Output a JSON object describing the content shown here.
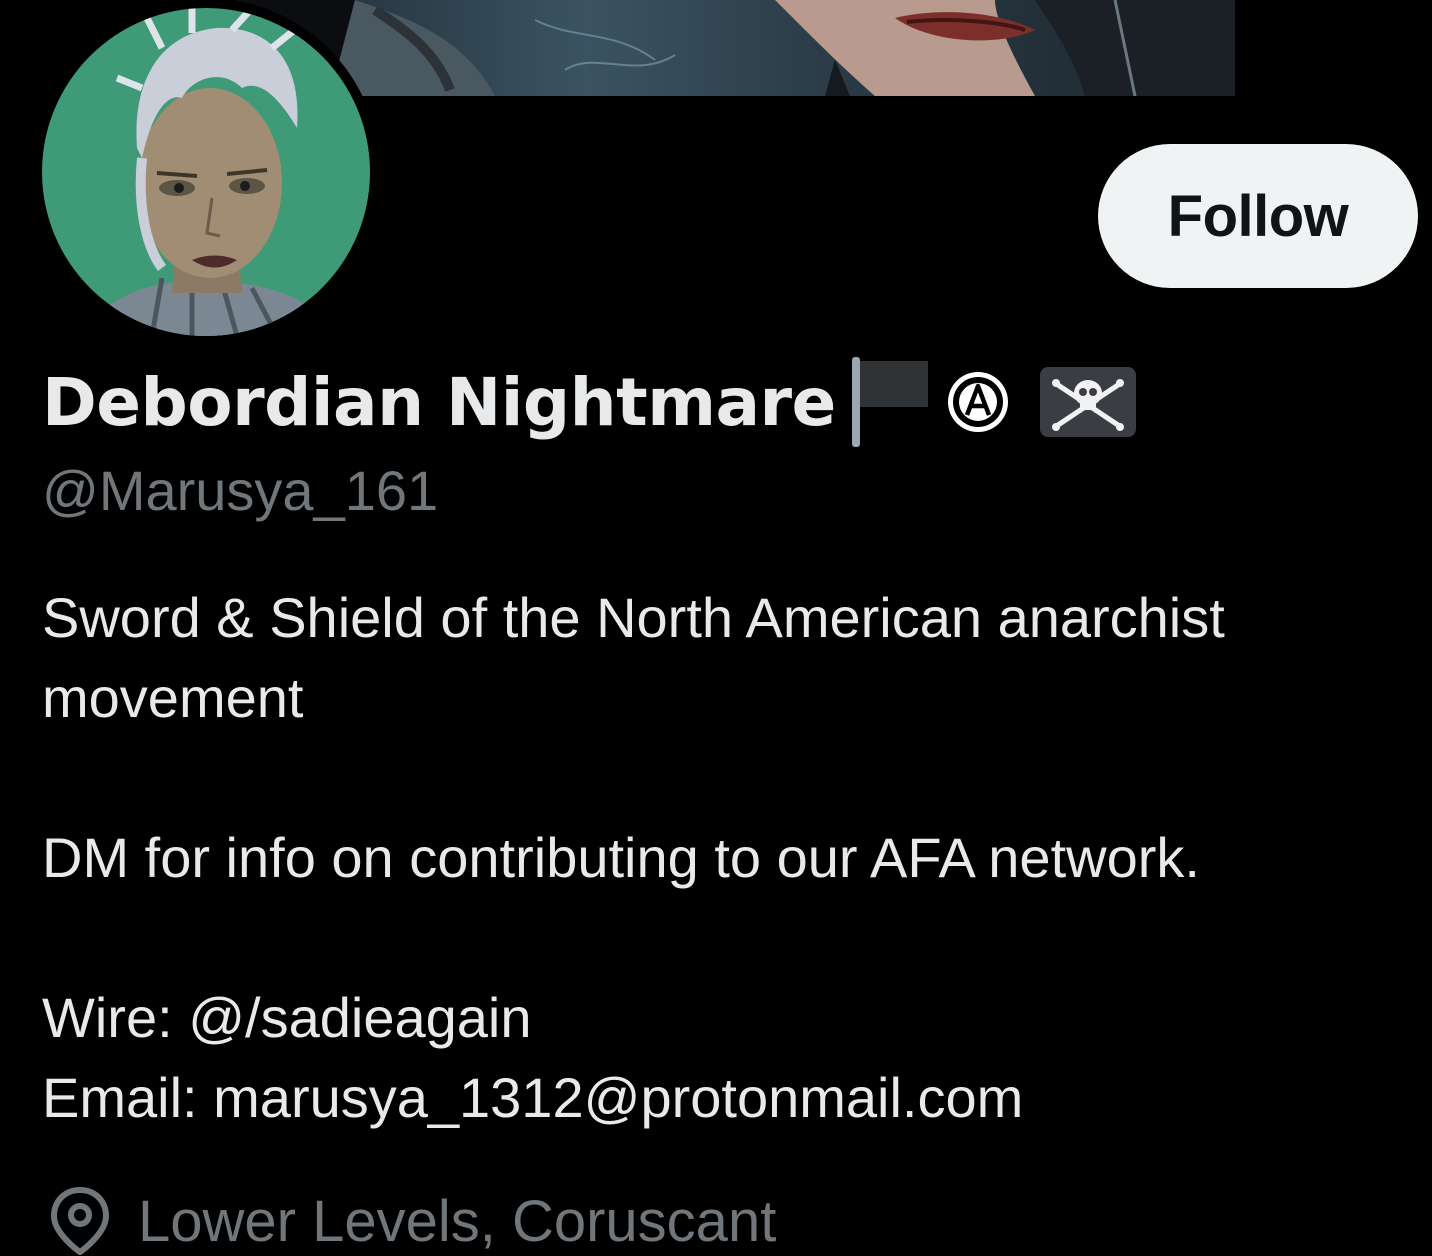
{
  "profile": {
    "display_name": "Debordian Nightmare",
    "name_emojis": [
      "black-flag-icon",
      "circled-a-anarchy-icon",
      "skull-and-crossbones-icon"
    ],
    "handle": "@Marusya_161",
    "follow_label": "Follow",
    "bio": {
      "line1": "Sword & Shield of the North American anarchist movement",
      "line2": "DM for info on contributing to our AFA network.",
      "line3": "Wire: @/sadieagain",
      "line4": "Email: marusya_1312@protonmail.com"
    },
    "location": "Lower Levels, Coruscant",
    "location_icon": "location-pin-icon"
  },
  "colors": {
    "background": "#000000",
    "primary_text": "#e7e9ea",
    "secondary_text": "#71767b",
    "follow_button_bg": "#eff3f4",
    "follow_button_text": "#0f1419"
  }
}
